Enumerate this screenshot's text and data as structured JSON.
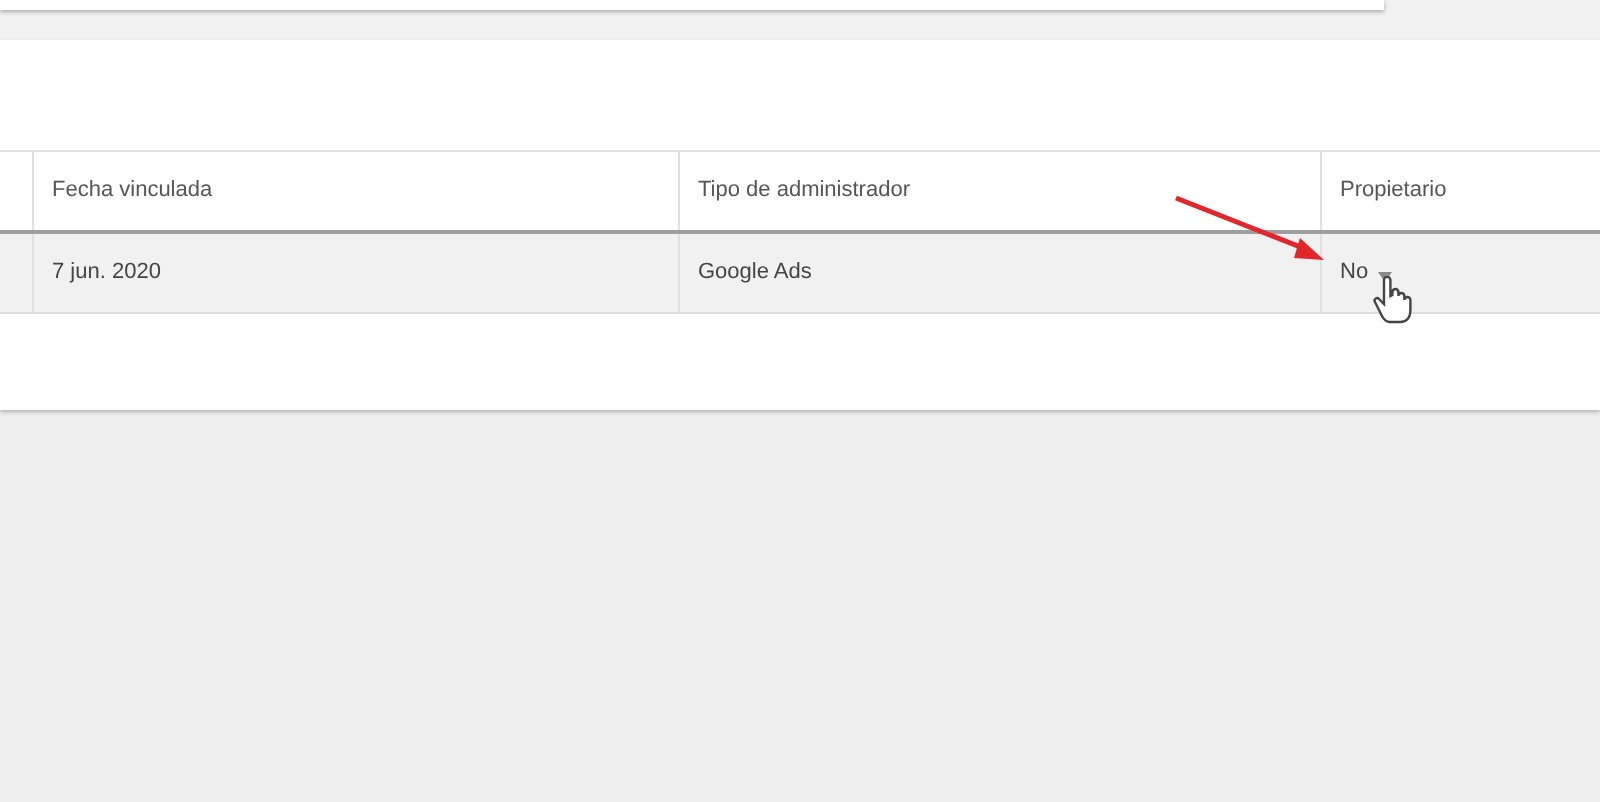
{
  "table": {
    "columns": [
      {
        "label": "Fecha vinculada"
      },
      {
        "label": "Tipo de administrador"
      },
      {
        "label": "Propietario"
      }
    ],
    "rows": [
      {
        "cells": [
          "7 jun. 2020",
          "Google Ads",
          "No"
        ]
      }
    ]
  }
}
